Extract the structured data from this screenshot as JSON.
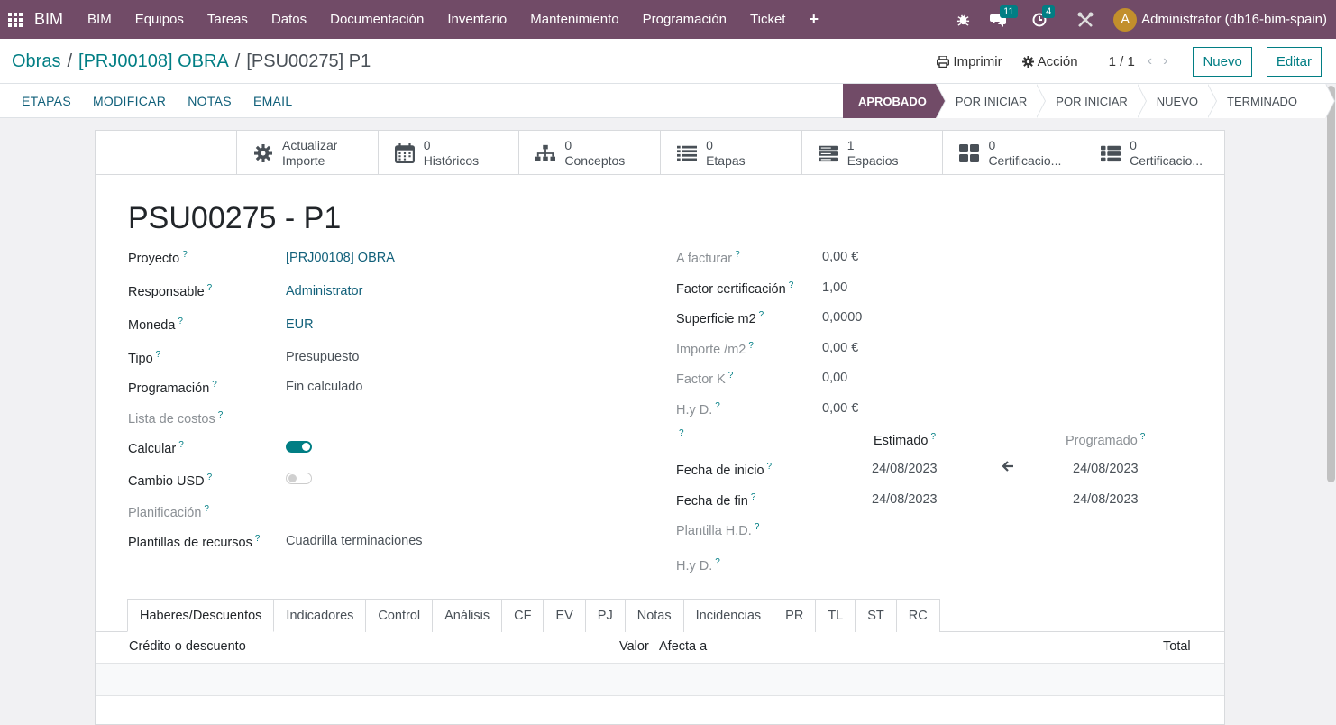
{
  "topbar": {
    "brand": "BIM",
    "menu": [
      "BIM",
      "Equipos",
      "Tareas",
      "Datos",
      "Documentación",
      "Inventario",
      "Mantenimiento",
      "Programación",
      "Ticket"
    ],
    "messages_count": "11",
    "activities_count": "4",
    "avatar_letter": "A",
    "user": "Administrator (db16-bim-spain)"
  },
  "breadcrumb": {
    "root": "Obras",
    "parent": "[PRJ00108] OBRA",
    "current": "[PSU00275] P1"
  },
  "actions": {
    "print": "Imprimir",
    "action": "Acción",
    "pager": "1 / 1",
    "new": "Nuevo",
    "edit": "Editar"
  },
  "statusbar": {
    "buttons": [
      "ETAPAS",
      "MODIFICAR",
      "NOTAS",
      "EMAIL"
    ],
    "stages": [
      "APROBADO",
      "POR INICIAR",
      "POR INICIAR",
      "NUEVO",
      "TERMINADO"
    ]
  },
  "smart_buttons": [
    {
      "value": "Actualizar",
      "label": "Importe",
      "icon": "gear-icon"
    },
    {
      "value": "0",
      "label": "Históricos",
      "icon": "calendar-icon"
    },
    {
      "value": "0",
      "label": "Conceptos",
      "icon": "sitemap-icon"
    },
    {
      "value": "0",
      "label": "Etapas",
      "icon": "list-icon"
    },
    {
      "value": "1",
      "label": "Espacios",
      "icon": "server-icon"
    },
    {
      "value": "0",
      "label": "Certificacio...",
      "icon": "grid-icon"
    },
    {
      "value": "0",
      "label": "Certificacio...",
      "icon": "list-icon"
    }
  ],
  "record_title": "PSU00275 - P1",
  "left_fields": {
    "proyecto": {
      "label": "Proyecto",
      "value": "[PRJ00108] OBRA"
    },
    "responsable": {
      "label": "Responsable",
      "value": "Administrator"
    },
    "moneda": {
      "label": "Moneda",
      "value": "EUR"
    },
    "tipo": {
      "label": "Tipo",
      "value": "Presupuesto"
    },
    "programacion": {
      "label": "Programación",
      "value": "Fin calculado"
    },
    "lista_costos": {
      "label": "Lista de costos"
    },
    "calcular": {
      "label": "Calcular",
      "checked": true
    },
    "cambio_usd": {
      "label": "Cambio USD",
      "checked": false
    },
    "planificacion": {
      "label": "Planificación"
    },
    "plantillas": {
      "label": "Plantillas de recursos",
      "value": "Cuadrilla terminaciones"
    }
  },
  "right_fields": {
    "a_facturar": {
      "label": "A facturar",
      "value": "0,00 €"
    },
    "factor_cert": {
      "label": "Factor certificación",
      "value": "1,00"
    },
    "superficie": {
      "label": "Superficie m2",
      "value": "0,0000"
    },
    "importe_m2": {
      "label": "Importe /m2",
      "value": "0,00 €"
    },
    "factor_k": {
      "label": "Factor K",
      "value": "0,00"
    },
    "hyd": {
      "label": "H.y D.",
      "value": "0,00 €"
    },
    "estimado": "Estimado",
    "programado": "Programado",
    "fecha_inicio": {
      "label": "Fecha de inicio",
      "estimado": "24/08/2023",
      "programado": "24/08/2023"
    },
    "fecha_fin": {
      "label": "Fecha de fin",
      "estimado": "24/08/2023",
      "programado": "24/08/2023"
    },
    "plantilla_hd": {
      "label": "Plantilla H.D."
    },
    "hyd2": {
      "label": "H.y D."
    }
  },
  "tabs": [
    "Haberes/Descuentos",
    "Indicadores",
    "Control",
    "Análisis",
    "CF",
    "EV",
    "PJ",
    "Notas",
    "Incidencias",
    "PR",
    "TL",
    "ST",
    "RC"
  ],
  "table": {
    "col_credito": "Crédito o descuento",
    "col_valor": "Valor",
    "col_afecta": "Afecta a",
    "col_total": "Total"
  },
  "colors": {
    "brand": "#714b67",
    "accent": "#017e84"
  }
}
